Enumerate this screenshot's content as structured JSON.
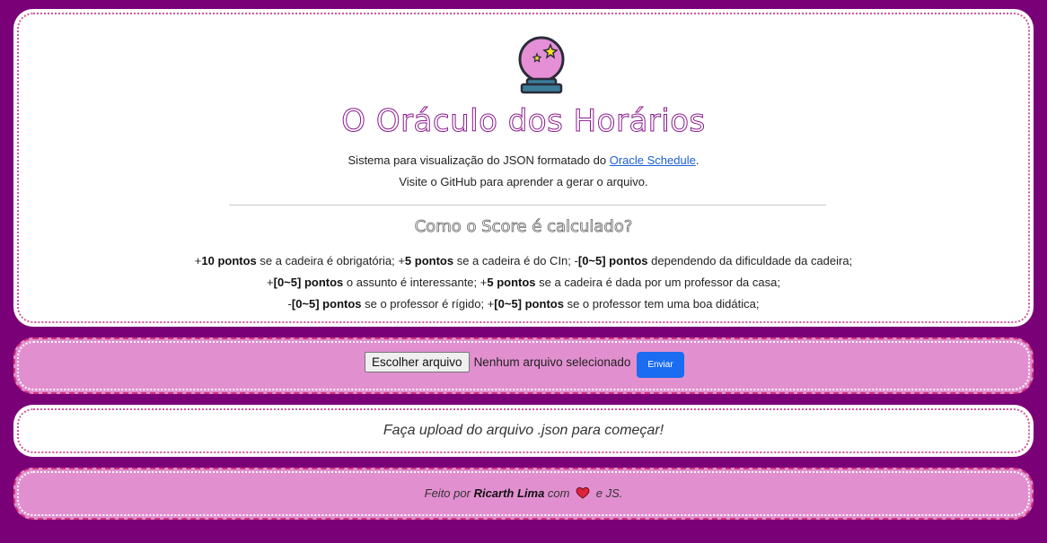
{
  "header": {
    "title": "O Oráculo dos Horários",
    "description_prefix": "Sistema para visualização do JSON formatado do ",
    "description_link": "Oracle Schedule",
    "description_suffix": ".",
    "description_line2": "Visite o GitHub para aprender a gerar o arquivo.",
    "score_title": "Como o Score é calculado?"
  },
  "score_rules": {
    "line1": [
      {
        "sign": "+",
        "bold": "10 pontos",
        "text": " se a cadeira é obrigatória; "
      },
      {
        "sign": "+",
        "bold": "5 pontos",
        "text": " se a cadeira é do CIn; "
      },
      {
        "sign": "-",
        "bold": "[0~5] pontos",
        "text": " dependendo da dificuldade da cadeira;"
      }
    ],
    "line2": [
      {
        "sign": "+",
        "bold": "[0~5] pontos",
        "text": " o assunto é interessante; "
      },
      {
        "sign": "+",
        "bold": "5 pontos",
        "text": " se a cadeira é dada por um professor da casa;"
      }
    ],
    "line3": [
      {
        "sign": "-",
        "bold": "[0~5] pontos",
        "text": " se o professor é rígido; "
      },
      {
        "sign": "+",
        "bold": "[0~5] pontos",
        "text": " se o professor tem uma boa didática;"
      }
    ]
  },
  "upload": {
    "choose_file_label": "Escolher arquivo",
    "no_file_text": "Nenhum arquivo selecionado",
    "submit_label": "Enviar"
  },
  "message": {
    "prompt": "Faça upload do arquivo .json para começar!"
  },
  "footer": {
    "prefix": "Feito por ",
    "author": "Ricarth Lima",
    "middle": " com ",
    "suffix": " e JS."
  },
  "colors": {
    "background": "#7a0078",
    "pink_card": "#e28fd0",
    "accent_button": "#1a6cf0",
    "title_stroke": "#8a1a8c"
  },
  "icons": {
    "logo": "crystal-ball-icon",
    "heart": "heart-icon"
  }
}
